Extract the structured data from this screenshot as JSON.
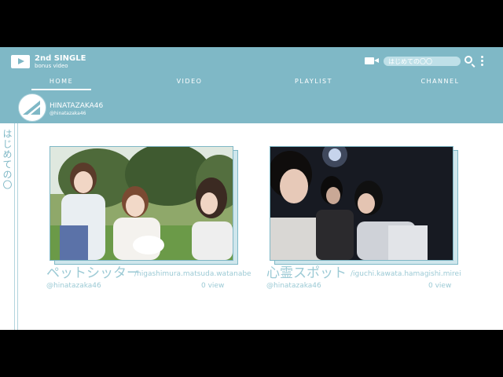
{
  "header": {
    "title": "2nd SINGLE",
    "subtitle": "bonus video",
    "search_placeholder": "はじめての〇〇"
  },
  "nav": {
    "tabs": [
      {
        "label": "HOME",
        "active": true
      },
      {
        "label": "VIDEO",
        "active": false
      },
      {
        "label": "PLAYLIST",
        "active": false
      },
      {
        "label": "CHANNEL",
        "active": false
      }
    ]
  },
  "channel": {
    "name": "HINATAZAKA46",
    "handle": "@hinatazaka46"
  },
  "side_label": "はじめての〇",
  "videos": [
    {
      "title": "ペットシッター",
      "members": "/higashimura.matsuda.watanabe",
      "channel": "@hinatazaka46",
      "views": "0 view"
    },
    {
      "title": "心霊スポット",
      "members": "/iguchi.kawata.hamagishi.mirei",
      "channel": "@hinatazaka46",
      "views": "0 view"
    }
  ],
  "colors": {
    "accent": "#7fb8c6",
    "text_light": "#9ccad5"
  },
  "icons": [
    "play-icon",
    "camera-icon",
    "search-icon",
    "more-icon",
    "logo-icon"
  ]
}
